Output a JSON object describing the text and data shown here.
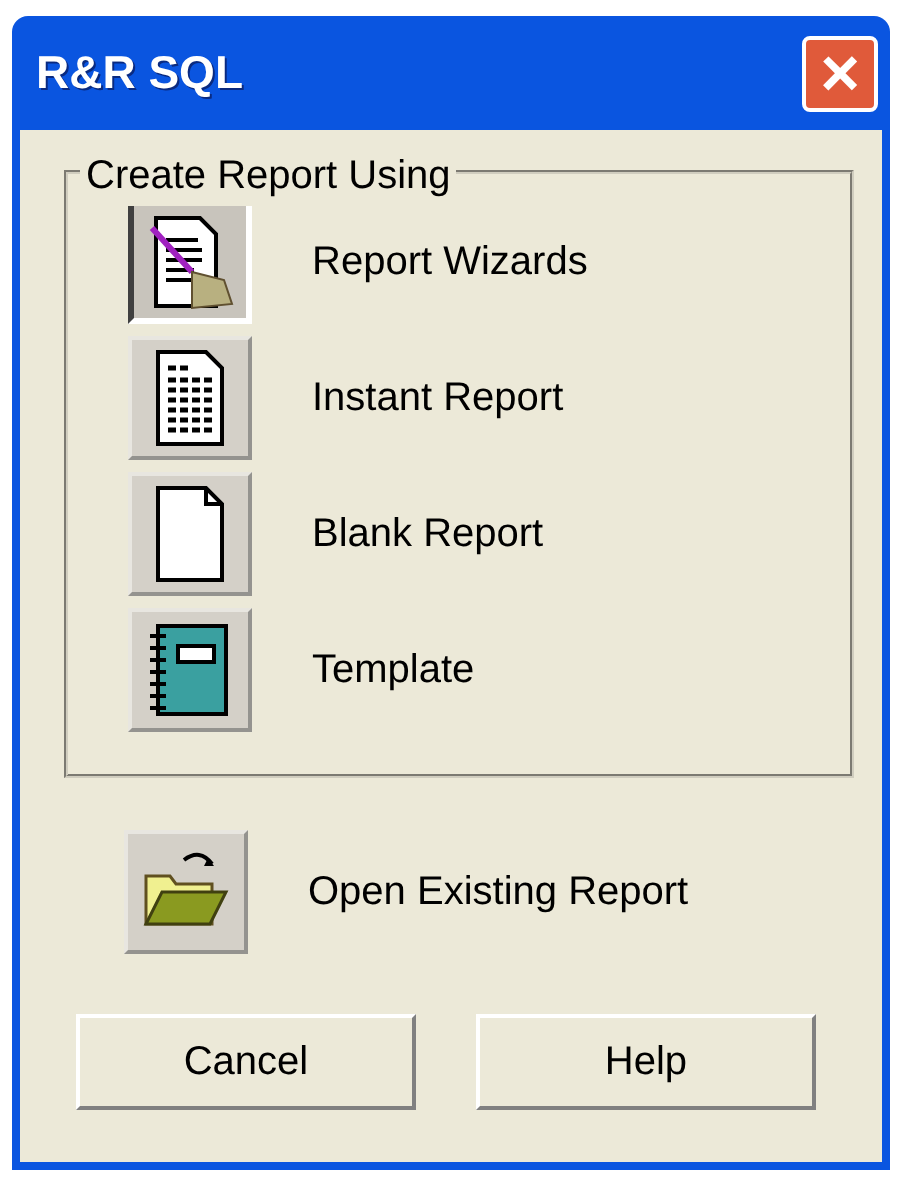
{
  "window": {
    "title": "R&R SQL",
    "close": "×"
  },
  "group": {
    "legend": "Create Report Using",
    "options": [
      {
        "kind": "wizard",
        "label": "Report Wizards",
        "selected": true
      },
      {
        "kind": "instant",
        "label": "Instant Report",
        "selected": false
      },
      {
        "kind": "blank",
        "label": "Blank Report",
        "selected": false
      },
      {
        "kind": "template",
        "label": "Template",
        "selected": false
      }
    ]
  },
  "open_existing": {
    "kind": "folder",
    "label": "Open Existing Report"
  },
  "buttons": [
    "Cancel",
    "Help"
  ]
}
